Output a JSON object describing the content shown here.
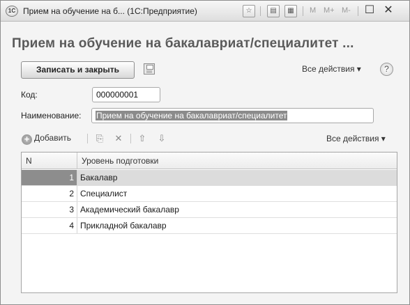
{
  "window": {
    "app_icon": "1С",
    "title": "Прием на обучение на б...  (1С:Предприятие)",
    "toolbar_m": [
      "M",
      "M+",
      "M-"
    ],
    "controls": {
      "close": "✕"
    }
  },
  "form": {
    "heading": "Прием на обучение на бакалавриат/специалитет ...",
    "save_close_label": "Записать и закрыть",
    "all_actions_label": "Все действия ▾",
    "help_label": "?",
    "code_label": "Код:",
    "code_value": "000000001",
    "name_label": "Наименование:",
    "name_value": "Прием на обучение на бакалавриат/специалитет"
  },
  "table_toolbar": {
    "add_label": "Добавить",
    "all_actions_label": "Все действия ▾"
  },
  "table": {
    "columns": [
      "N",
      "Уровень подготовки"
    ],
    "rows": [
      {
        "n": "1",
        "level": "Бакалавр"
      },
      {
        "n": "2",
        "level": "Специалист"
      },
      {
        "n": "3",
        "level": "Академический бакалавр"
      },
      {
        "n": "4",
        "level": "Прикладной бакалавр"
      }
    ],
    "selected_row": 1
  },
  "icons": {
    "app": "1c-logo-icon",
    "favorite": "star-icon",
    "calc": "calculator-icon",
    "calendar": "calendar-icon",
    "save": "floppy-disk-icon",
    "help": "help-icon",
    "add": "plus-circle-icon",
    "copy": "copy-icon",
    "delete": "cross-icon",
    "move_up": "arrow-up-icon",
    "move_down": "arrow-down-icon"
  }
}
